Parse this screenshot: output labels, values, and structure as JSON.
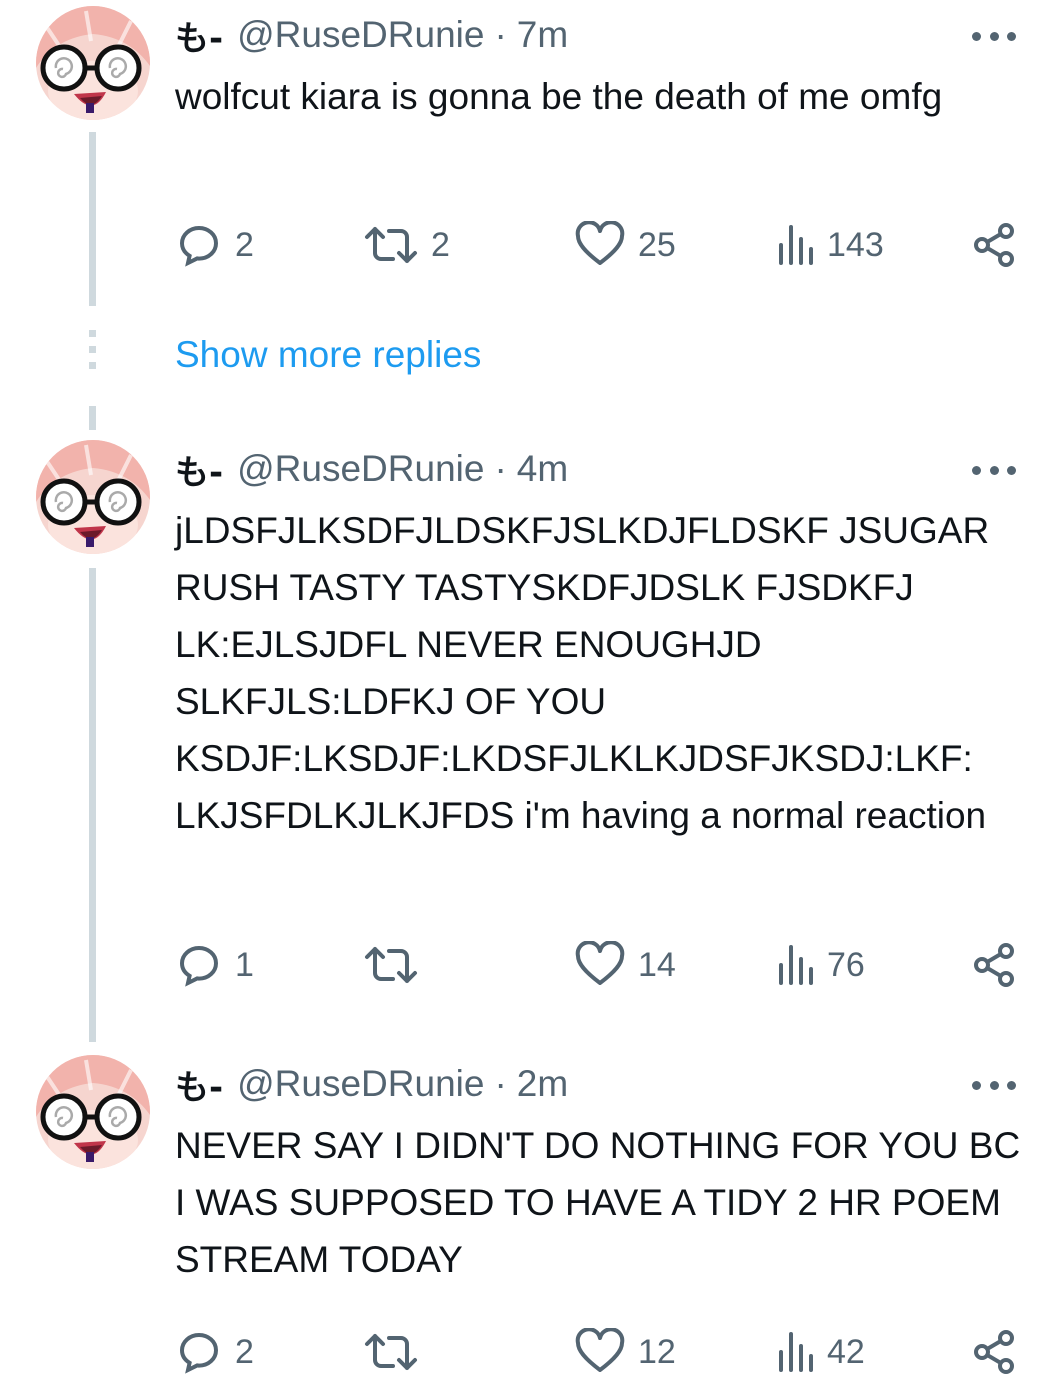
{
  "tweets": [
    {
      "author": "も-",
      "handle": "@RuseDRunie",
      "separator": "·",
      "time": "7m",
      "text": "wolfcut kiara is gonna be the death of me omfg",
      "replies": "2",
      "reposts": "2",
      "likes": "25",
      "views": "143"
    },
    {
      "author": "も-",
      "handle": "@RuseDRunie",
      "separator": "·",
      "time": "4m",
      "text": "jLDSFJLKSDFJLDSKFJSLKDJFLDSKF JSUGAR RUSH TASTY TASTYSKDFJDSLK FJSDKFJ LK:EJLSJDFL NEVER ENOUGHJD SLKFJLS:LDFKJ OF YOU KSDJF:LKSDJF:LKDSFJLKLKJDSFJKSDJ:LKF: LKJSFDLKJLKJFDS i'm having a normal reaction",
      "replies": "1",
      "reposts": "",
      "likes": "14",
      "views": "76"
    },
    {
      "author": "も-",
      "handle": "@RuseDRunie",
      "separator": "·",
      "time": "2m",
      "text": "NEVER SAY I DIDN'T DO NOTHING FOR YOU BC I WAS SUPPOSED TO HAVE A TIDY 2 HR POEM STREAM TODAY",
      "replies": "2",
      "reposts": "",
      "likes": "12",
      "views": "42"
    }
  ],
  "show_more_replies": "Show more replies",
  "colors": {
    "text": "#0f1419",
    "secondary": "#536471",
    "link": "#1d9bf0",
    "thread_line": "#cfd9de"
  },
  "icons": [
    "reply-icon",
    "repost-icon",
    "like-icon",
    "views-icon",
    "share-icon",
    "more-icon",
    "avatar"
  ]
}
